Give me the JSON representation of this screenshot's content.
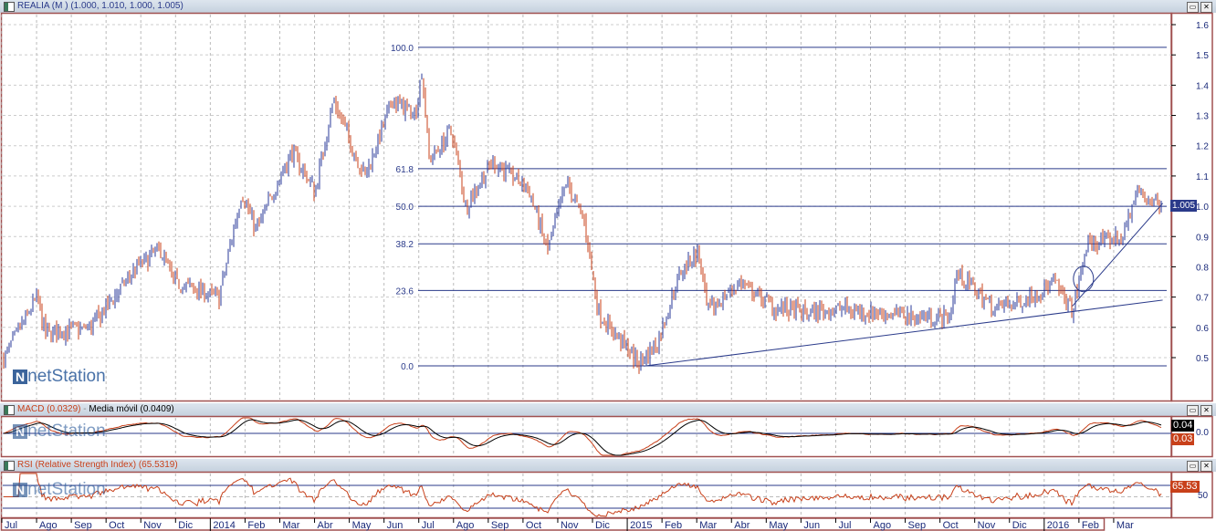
{
  "main": {
    "symbol": "REALIA (M ) (1.000, 1.010, 1.000, 1.005)",
    "price_flag": "1.005",
    "logo": "netStation"
  },
  "macd": {
    "label": "MACD (0.0329)",
    "sep": " - ",
    "ma_label": "Media móvil (0.0409)",
    "val_signal": "0.04",
    "val_macd": "0.03",
    "axis": "0.0"
  },
  "rsi": {
    "label": "RSI (Relative Strength Index) (65.5319)",
    "val": "65.53",
    "axis": "50"
  },
  "window_buttons": {
    "maximize": "▭",
    "close": "✕"
  },
  "colors": {
    "up": "#2a3a9a",
    "down": "#c8401a",
    "fib": "#2a3a8a",
    "border": "#a05050"
  },
  "chart_data": {
    "type": "bar",
    "title": "REALIA (M)",
    "x_ticks": [
      "Jul",
      "Ago",
      "Sep",
      "Oct",
      "Nov",
      "Dic",
      "2014",
      "Feb",
      "Mar",
      "Abr",
      "May",
      "Jun",
      "Jul",
      "Ago",
      "Sep",
      "Oct",
      "Nov",
      "Dic",
      "2015",
      "Feb",
      "Mar",
      "Abr",
      "May",
      "Jun",
      "Jul",
      "Ago",
      "Sep",
      "Oct",
      "Nov",
      "Dic",
      "2016",
      "Feb",
      "Mar"
    ],
    "y_ticks": [
      "1.6",
      "1.5",
      "1.4",
      "1.3",
      "1.2",
      "1.1",
      "1.0",
      "0.9",
      "0.8",
      "0.7",
      "0.6",
      "0.5"
    ],
    "ylim": [
      0.4,
      1.65
    ],
    "price_path_month_index_close": [
      [
        -0.13,
        0.5
      ],
      [
        0.79,
        0.7
      ],
      [
        1.05,
        0.58
      ],
      [
        2.36,
        0.6
      ],
      [
        3.68,
        0.8
      ],
      [
        4.34,
        0.86
      ],
      [
        4.73,
        0.75
      ],
      [
        6.04,
        0.7
      ],
      [
        6.7,
        1.05
      ],
      [
        7.09,
        0.92
      ],
      [
        8.14,
        1.18
      ],
      [
        8.8,
        1.05
      ],
      [
        9.33,
        1.35
      ],
      [
        9.85,
        1.2
      ],
      [
        10.25,
        1.1
      ],
      [
        11.04,
        1.35
      ],
      [
        11.69,
        1.3
      ],
      [
        11.88,
        1.45
      ],
      [
        12.09,
        1.15
      ],
      [
        12.74,
        1.25
      ],
      [
        13.14,
        1.0
      ],
      [
        13.93,
        1.15
      ],
      [
        14.98,
        1.05
      ],
      [
        15.5,
        0.85
      ],
      [
        16.03,
        1.08
      ],
      [
        16.55,
        0.95
      ],
      [
        16.82,
        0.75
      ],
      [
        16.95,
        0.65
      ],
      [
        18.13,
        0.48
      ],
      [
        18.65,
        0.55
      ],
      [
        19.31,
        0.78
      ],
      [
        19.83,
        0.85
      ],
      [
        20.1,
        0.65
      ],
      [
        21.02,
        0.75
      ],
      [
        22.07,
        0.66
      ],
      [
        22.99,
        0.65
      ],
      [
        23.91,
        0.66
      ],
      [
        25.75,
        0.64
      ],
      [
        27.06,
        0.63
      ],
      [
        27.27,
        0.78
      ],
      [
        28.38,
        0.66
      ],
      [
        29.43,
        0.7
      ],
      [
        30.08,
        0.75
      ],
      [
        30.61,
        0.65
      ],
      [
        31.0,
        0.87
      ],
      [
        32.05,
        0.9
      ],
      [
        32.45,
        1.05
      ],
      [
        33.11,
        1.005
      ]
    ],
    "fibonacci": [
      {
        "label": "100.0",
        "value": 1.525
      },
      {
        "label": "61.8",
        "value": 1.124
      },
      {
        "label": "50.0",
        "value": 1.0
      },
      {
        "label": "38.2",
        "value": 0.876
      },
      {
        "label": "23.6",
        "value": 0.722
      },
      {
        "label": "0.0",
        "value": 0.473
      }
    ],
    "trendlines": [
      [
        [
          18.27,
          0.472
        ],
        [
          33.2,
          0.69
        ]
      ],
      [
        [
          30.6,
          0.67
        ],
        [
          33.2,
          1.01
        ]
      ]
    ],
    "circle": [
      30.92,
      0.76
    ],
    "macd_value": 0.0329,
    "macd_signal": 0.0409,
    "rsi_value": 65.5319,
    "rsi_levels": [
      70,
      50,
      30
    ]
  }
}
